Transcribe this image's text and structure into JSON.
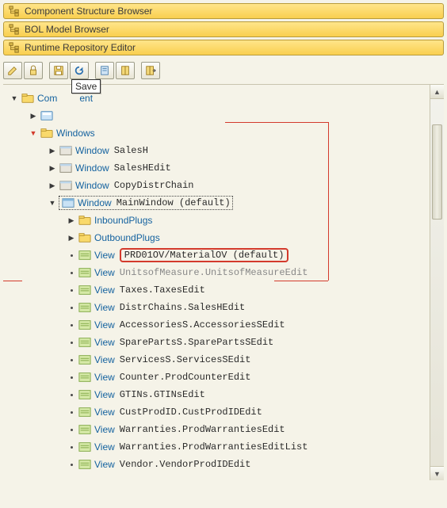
{
  "panels": {
    "p1": "Component Structure Browser",
    "p2": "BOL Model Browser",
    "p3": "Runtime Repository Editor"
  },
  "toolbar": {
    "save_tooltip": "Save"
  },
  "tree": {
    "root_type": "",
    "root_name": "ent",
    "models_type": "",
    "windows_type": "Windows",
    "win1_type": "Window",
    "win1_name": "SalesH",
    "win2_type": "Window",
    "win2_name": "SalesHEdit",
    "win3_type": "Window",
    "win3_name": "CopyDistrChain",
    "win4_type": "Window",
    "win4_name": "MainWindow (default)",
    "inbound": "InboundPlugs",
    "outbound": "OutboundPlugs",
    "v1_type": "View",
    "v1_name": "PRD01OV/MaterialOV (default)",
    "v2_type": "View",
    "v2_name": "UnitsofMeasure.UnitsofMeasureEdit",
    "v3_type": "View",
    "v3_name": "Taxes.TaxesEdit",
    "v4_type": "View",
    "v4_name": "DistrChains.SalesHEdit",
    "v5_type": "View",
    "v5_name": "AccessoriesS.AccessoriesSEdit",
    "v6_type": "View",
    "v6_name": "SparePartsS.SparePartsSEdit",
    "v7_type": "View",
    "v7_name": "ServicesS.ServicesSEdit",
    "v8_type": "View",
    "v8_name": "Counter.ProdCounterEdit",
    "v9_type": "View",
    "v9_name": "GTINs.GTINsEdit",
    "v10_type": "View",
    "v10_name": "CustProdID.CustProdIDEdit",
    "v11_type": "View",
    "v11_name": "Warranties.ProdWarrantiesEdit",
    "v12_type": "View",
    "v12_name": "Warranties.ProdWarrantiesEditList",
    "v13_type": "View",
    "v13_name": "Vendor.VendorProdIDEdit"
  },
  "root_prefix": "Com"
}
